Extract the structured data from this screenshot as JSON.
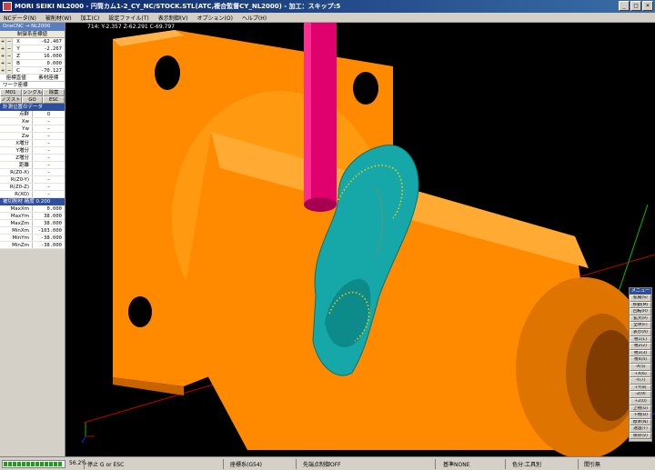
{
  "window": {
    "title": "MORI SEIKI NL2000 - 円筒カム1-2_CY_NC/STOCK.STL(ATC,複合監督CY_NL2000) - 加工：スキップ:5",
    "min_label": "_",
    "max_label": "□",
    "close_label": "×"
  },
  "menu": [
    {
      "label": "NCデータ(N)"
    },
    {
      "label": "被削材(W)"
    },
    {
      "label": "加工(C)"
    },
    {
      "label": "設定ファイル(T)"
    },
    {
      "label": "表示制御(V)"
    },
    {
      "label": "オプション(O)"
    },
    {
      "label": "ヘルプ(H)"
    }
  ],
  "panel": {
    "cnc_header": "OneCNC → NL2000",
    "coord_title": "制御系座標値",
    "axes": [
      {
        "pm": "+",
        "name": "X",
        "value": "-62.467"
      },
      {
        "pm": "+",
        "name": "Y",
        "value": "-2.267"
      },
      {
        "pm": "+",
        "name": "Z",
        "value": "16.000"
      },
      {
        "pm": "+",
        "name": "B",
        "value": "0.000"
      },
      {
        "pm": "+",
        "name": "C",
        "value": "-70.127"
      }
    ],
    "mode_row": [
      "座標直値",
      "素材座標"
    ],
    "work_label": "ワーク座標",
    "buttons1": [
      "M01",
      "シングル",
      "除案"
    ],
    "buttons2": [
      "ノズストップ",
      "GO",
      "ESC"
    ],
    "measure_title": "計測位置のデータ",
    "measure": [
      {
        "k": "点群",
        "v": "0"
      },
      {
        "k": "Xw",
        "v": "–"
      },
      {
        "k": "Yw",
        "v": "–"
      },
      {
        "k": "Zw",
        "v": "–"
      },
      {
        "k": "X増分",
        "v": "–"
      },
      {
        "k": "Y増分",
        "v": "–"
      },
      {
        "k": "Z増分",
        "v": "–"
      },
      {
        "k": "距離",
        "v": "–"
      },
      {
        "k": "R(Z0-X)",
        "v": "–"
      },
      {
        "k": "R(Z0-Y)",
        "v": "–"
      },
      {
        "k": "R(Z0-Z)",
        "v": "–"
      },
      {
        "k": "R(XO)",
        "v": "–"
      }
    ],
    "stock_title": "被切削材  精度 0.200",
    "stock": [
      {
        "k": "MaxXm",
        "v": "0.000"
      },
      {
        "k": "MaxYm",
        "v": "38.000"
      },
      {
        "k": "MaxZm",
        "v": "38.000"
      },
      {
        "k": "MinXm",
        "v": "-103.000"
      },
      {
        "k": "MinYm",
        "v": "-38.000"
      },
      {
        "k": "MinZm",
        "v": "-38.000"
      }
    ]
  },
  "viewport": {
    "coord_readout": "714: Y-2.357 Z-62.291 C-69.797"
  },
  "right_menu": {
    "title": "メニュー",
    "items": [
      "拡縮(S)",
      "移動(M)",
      "回転(R)",
      "拡大(P)",
      "全体(F)",
      "表示(A)",
      "視1(1)",
      "視2(2)",
      "視3(3)",
      "視4(4)",
      "-X(5)",
      "+X(6)",
      "-Y(7)",
      "+Y(8)",
      "-Z(9)",
      "+Z(0)",
      "上視(U)",
      "下視(D)",
      "標準(N)",
      "透過(T)",
      "保存(V)"
    ]
  },
  "status": {
    "progress_segments": 13,
    "zoom": "56.2%",
    "stop": "停止 G or ESC",
    "coord_sys": "座標系(G54)",
    "tip_ctrl": "先端点制御OFF",
    "base": "基準NONE",
    "color_mode": "色分:工具別",
    "interval": "間引無"
  },
  "colors": {
    "part": "#ff8a00",
    "tool": "#e0006e",
    "cut_surface": "#16a8a8"
  }
}
